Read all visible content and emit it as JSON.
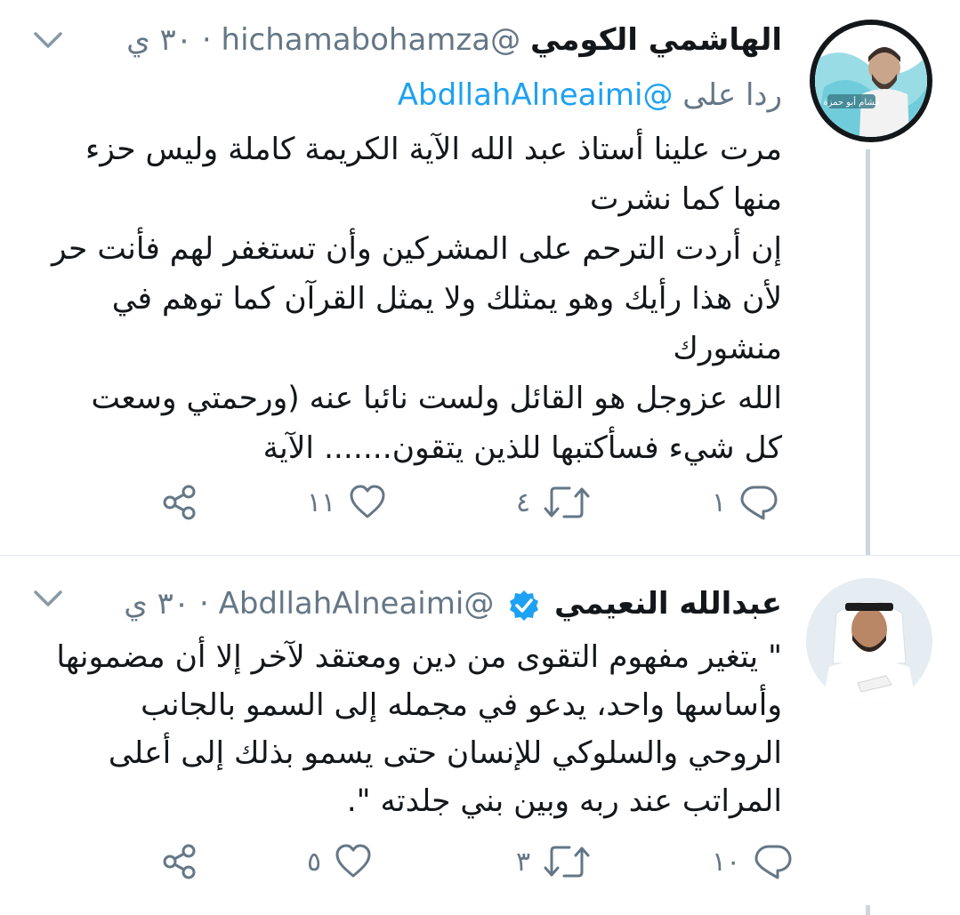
{
  "tweets": [
    {
      "author_name": "الهاشمي الكومي",
      "handle": "@hichamabohamza",
      "time": "٣٠ ي",
      "separator": "·",
      "reply_prefix": "ردا على",
      "reply_mention": "@Abdllah­Alneaimi",
      "text": "مرت علينا أستاذ عبد الله الآية الكريمة كاملة وليس حزء منها كما نشرت\nإن أردت الترحم على المشركين وأن تستغفر لهم فأنت حر لأن هذا رأيك وهو يمثلك ولا يمثل القرآن كما توهم في منشورك\nالله عزوجل هو القائل ولست نائبا عنه (ورحمتي وسعت كل شيء فسأكتبها للذين يتقون....... الآية",
      "counts": {
        "reply": "١",
        "retweet": "٤",
        "like": "١١"
      },
      "avatar_caption": "هشام أبو حمزة"
    },
    {
      "author_name": "عبدالله النعيمي",
      "handle": "@AbdllahAlneaimi",
      "time": "٣٠ ي",
      "separator": "·",
      "verified": true,
      "text": "\" يتغير مفهوم التقوى من دين ومعتقد لآخر إلا أن مضمونها وأساسها واحد، يدعو في مجمله إلى السمو بالجانب الروحي والسلوكي للإنسان حتى يسمو بذلك إلى أعلى المراتب عند ربه وبين بني جلدته \".",
      "counts": {
        "reply": "١٠",
        "retweet": "٣",
        "like": "٥"
      }
    }
  ],
  "colors": {
    "link": "#1da1f2",
    "muted": "#657786",
    "text": "#14171a",
    "thread": "#ccd6dd",
    "avatar1_bg": "#7fd3e0"
  },
  "icons": [
    "chevron-down-icon",
    "reply-icon",
    "retweet-icon",
    "like-icon",
    "share-icon",
    "verified-badge-icon"
  ]
}
